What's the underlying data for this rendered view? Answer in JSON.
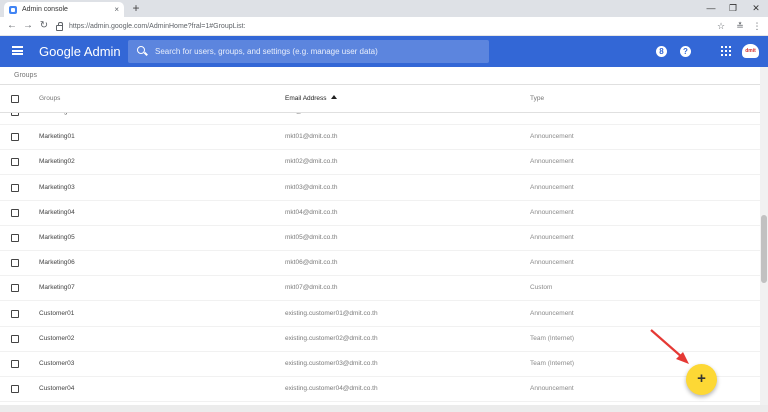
{
  "browser": {
    "tab_title": "Admin console",
    "tab_close": "×",
    "new_tab": "+",
    "url": "https://admin.google.com/AdminHome?fral=1#GroupList:",
    "controls": {
      "minimize": "—",
      "maximize": "❐",
      "close": "✕"
    },
    "nav": {
      "back": "←",
      "forward": "→",
      "reload": "↻"
    },
    "toolbar_icons": {
      "bookmark": "☆",
      "extension": "≛",
      "menu": "⋮"
    }
  },
  "header": {
    "brand": "Google Admin",
    "search_placeholder": "Search for users, groups, and settings (e.g. manage user data)",
    "notifications_badge": "8",
    "help": "?",
    "avatar_text": "dmit"
  },
  "breadcrumb": "Groups",
  "table": {
    "columns": {
      "groups": "Groups",
      "email": "Email Address",
      "type": "Type"
    },
    "sort": {
      "column": "Email Address",
      "direction": "ascending"
    },
    "rows": [
      {
        "name": "Marketing",
        "email": "mkt@dmit.co.th",
        "type": "Announcement"
      },
      {
        "name": "Marketing01",
        "email": "mkt01@dmit.co.th",
        "type": "Announcement"
      },
      {
        "name": "Marketing02",
        "email": "mkt02@dmit.co.th",
        "type": "Announcement"
      },
      {
        "name": "Marketing03",
        "email": "mkt03@dmit.co.th",
        "type": "Announcement"
      },
      {
        "name": "Marketing04",
        "email": "mkt04@dmit.co.th",
        "type": "Announcement"
      },
      {
        "name": "Marketing05",
        "email": "mkt05@dmit.co.th",
        "type": "Announcement"
      },
      {
        "name": "Marketing06",
        "email": "mkt06@dmit.co.th",
        "type": "Announcement"
      },
      {
        "name": "Marketing07",
        "email": "mkt07@dmit.co.th",
        "type": "Custom"
      },
      {
        "name": "Customer01",
        "email": "existing.customer01@dmit.co.th",
        "type": "Announcement"
      },
      {
        "name": "Customer02",
        "email": "existing.customer02@dmit.co.th",
        "type": "Team (Internet)"
      },
      {
        "name": "Customer03",
        "email": "existing.customer03@dmit.co.th",
        "type": "Team (Internet)"
      },
      {
        "name": "Customer04",
        "email": "existing.customer04@dmit.co.th",
        "type": "Announcement"
      }
    ]
  },
  "fab_label": "+",
  "colors": {
    "header": "#3367d6",
    "fab": "#fdd835",
    "annotation_arrow": "#e53935"
  }
}
